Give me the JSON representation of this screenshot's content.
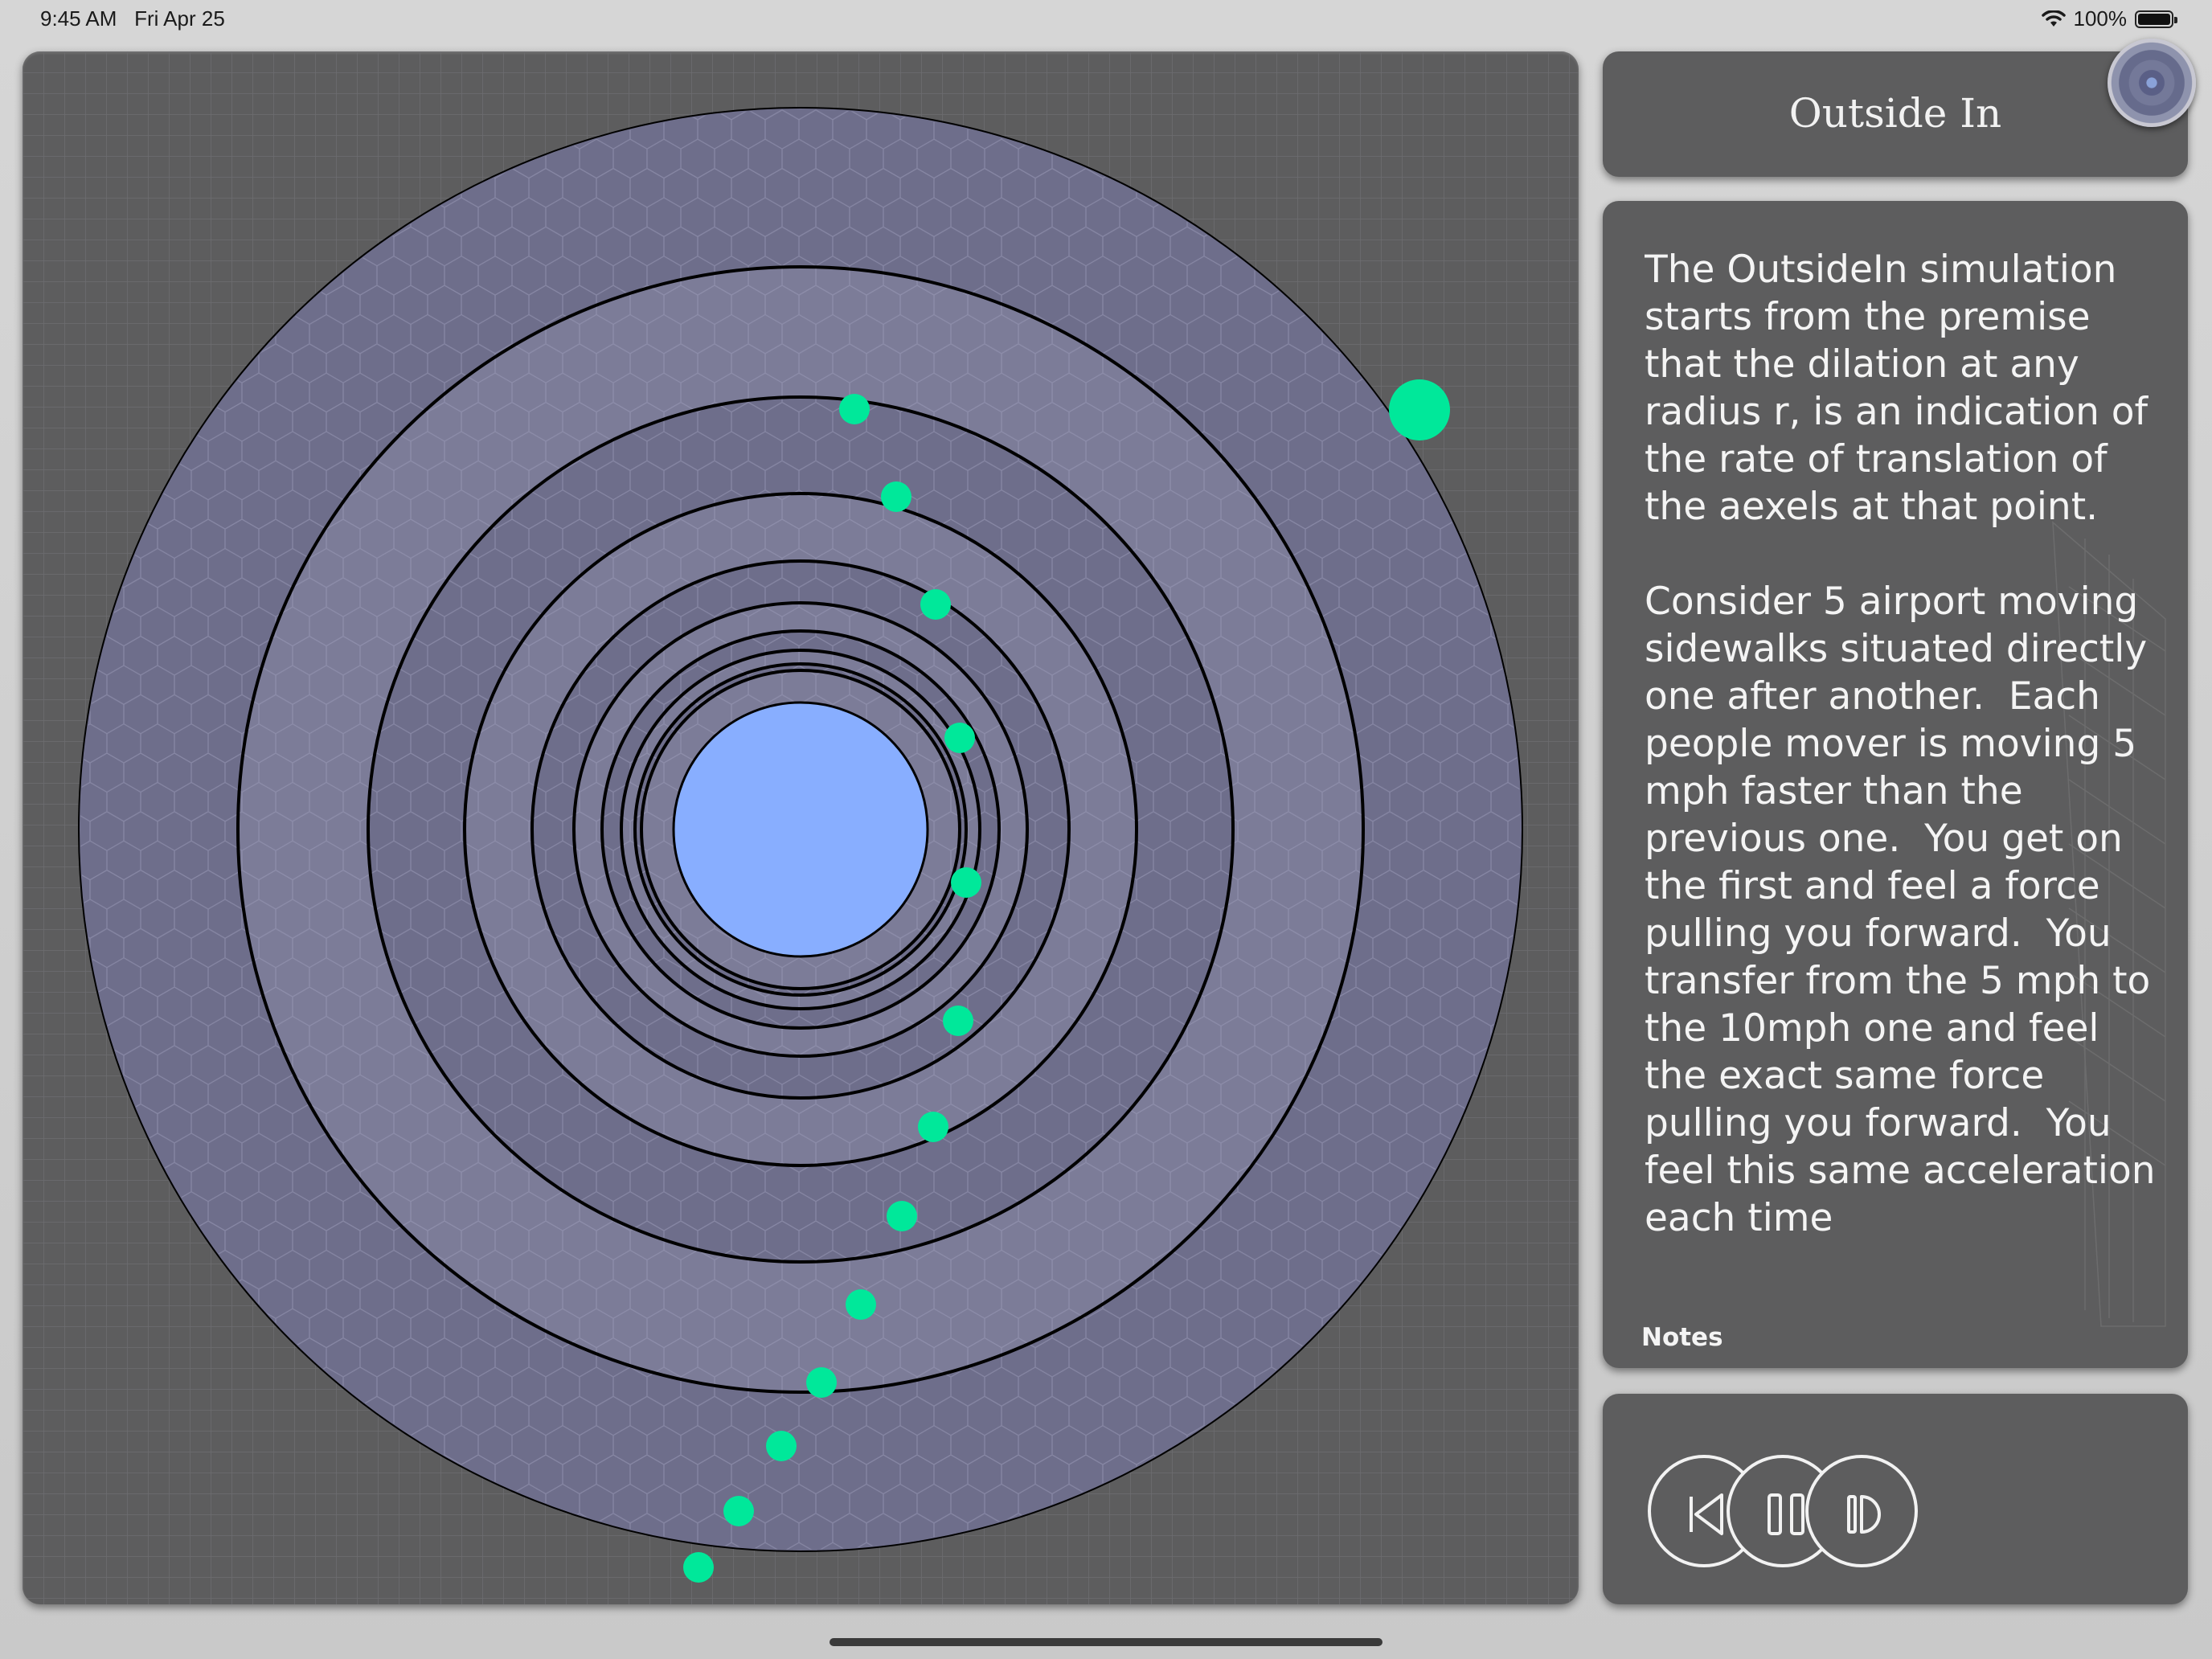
{
  "status_bar": {
    "time": "9:45 AM",
    "date": "Fri Apr 25",
    "battery_text": "100%",
    "icons": [
      "wifi-icon",
      "battery-icon"
    ]
  },
  "simulation": {
    "description": "concentric rings with green particles",
    "colors": {
      "panel_background": "#5d5d5e",
      "grid_lines": "#6a6a6c",
      "ring_fill": "#7c7c98",
      "ring_fill_alt": "#6e6e8b",
      "hex_pattern": "#8f8fad",
      "ring_stroke": "#000000",
      "center_body": "#88aeff",
      "particle": "#00e89a"
    },
    "ring_count": 10,
    "particle_count": 14
  },
  "title_panel": {
    "title": "Outside In",
    "logo_icon": "concentric-circles-logo-icon"
  },
  "notes_panel": {
    "text": "The OutsideIn simulation starts from the premise that the dilation at any radius r, is an indication of the rate of translation of the aexels at that point.\n\nConsider 5 airport moving sidewalks situated directly one after another.  Each people mover is moving 5 mph faster than the previous one.  You get on the first and feel a force pulling you forward.  You transfer from the 5 mph to the 10mph one and feel the exact same force pulling you forward.  You feel this same acceleration each time",
    "label": "Notes"
  },
  "controls": {
    "buttons": [
      {
        "name": "rewind-button",
        "icon": "rewind-icon"
      },
      {
        "name": "pause-button",
        "icon": "pause-icon"
      },
      {
        "name": "step-forward-button",
        "icon": "step-forward-icon"
      }
    ]
  }
}
